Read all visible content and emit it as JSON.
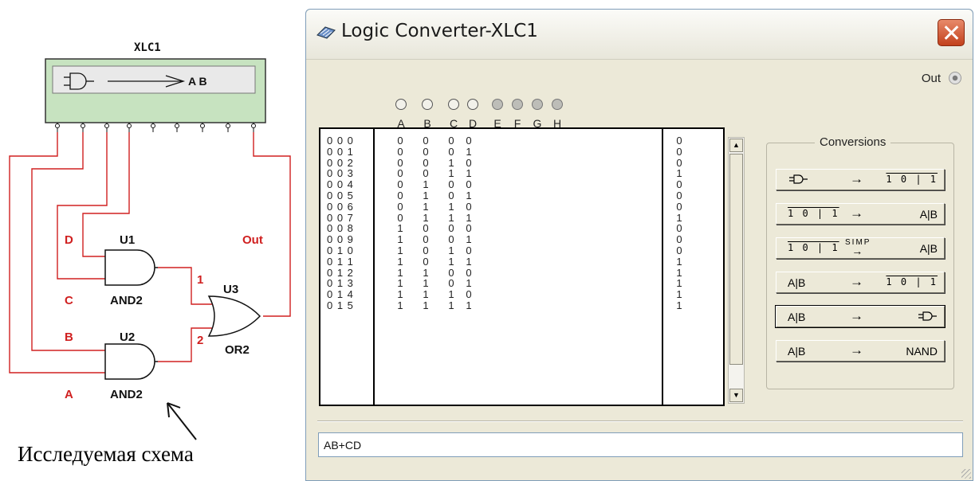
{
  "circuit": {
    "device_label": "XLC1",
    "device_text": "A B",
    "gates": [
      {
        "ref": "U1",
        "type": "AND2"
      },
      {
        "ref": "U2",
        "type": "AND2"
      },
      {
        "ref": "U3",
        "type": "OR2"
      }
    ],
    "net_labels": {
      "a": "A",
      "b": "B",
      "c": "C",
      "d": "D",
      "out": "Out",
      "n1": "1",
      "n2": "2"
    },
    "caption": "Исследуемая схема",
    "wire_color": "#d02020"
  },
  "window": {
    "title": "Logic Converter-XLC1",
    "out_label": "Out",
    "leds": [
      "A",
      "B",
      "C",
      "D",
      "E",
      "F",
      "G",
      "H"
    ],
    "table": {
      "index": [
        "0 0 0",
        "0 0 1",
        "0 0 2",
        "0 0 3",
        "0 0 4",
        "0 0 5",
        "0 0 6",
        "0 0 7",
        "0 0 8",
        "0 0 9",
        "0 1 0",
        "0 1 1",
        "0 1 2",
        "0 1 3",
        "0 1 4",
        "0 1 5"
      ],
      "rows": [
        [
          "0",
          "0",
          "0",
          "0"
        ],
        [
          "0",
          "0",
          "0",
          "1"
        ],
        [
          "0",
          "0",
          "1",
          "0"
        ],
        [
          "0",
          "0",
          "1",
          "1"
        ],
        [
          "0",
          "1",
          "0",
          "0"
        ],
        [
          "0",
          "1",
          "0",
          "1"
        ],
        [
          "0",
          "1",
          "1",
          "0"
        ],
        [
          "0",
          "1",
          "1",
          "1"
        ],
        [
          "1",
          "0",
          "0",
          "0"
        ],
        [
          "1",
          "0",
          "0",
          "1"
        ],
        [
          "1",
          "0",
          "1",
          "0"
        ],
        [
          "1",
          "0",
          "1",
          "1"
        ],
        [
          "1",
          "1",
          "0",
          "0"
        ],
        [
          "1",
          "1",
          "0",
          "1"
        ],
        [
          "1",
          "1",
          "1",
          "0"
        ],
        [
          "1",
          "1",
          "1",
          "1"
        ]
      ],
      "outputs": [
        "0",
        "0",
        "0",
        "1",
        "0",
        "0",
        "0",
        "1",
        "0",
        "0",
        "0",
        "1",
        "1",
        "1",
        "1",
        "1"
      ]
    },
    "conversions": {
      "title": "Conversions",
      "buttons": [
        {
          "left": "",
          "arrow": "→",
          "right": "1 0 | 1"
        },
        {
          "left": "1 0 | 1",
          "arrow": "→",
          "right": "A|B"
        },
        {
          "left": "1 0 | 1",
          "arrow": "SIMP",
          "right": "A|B"
        },
        {
          "left": "A|B",
          "arrow": "→",
          "right": "1 0 | 1"
        },
        {
          "left": "A|B",
          "arrow": "→",
          "right": ""
        },
        {
          "left": "A|B",
          "arrow": "→",
          "right": "NAND"
        }
      ]
    },
    "expression": "AB+CD"
  }
}
